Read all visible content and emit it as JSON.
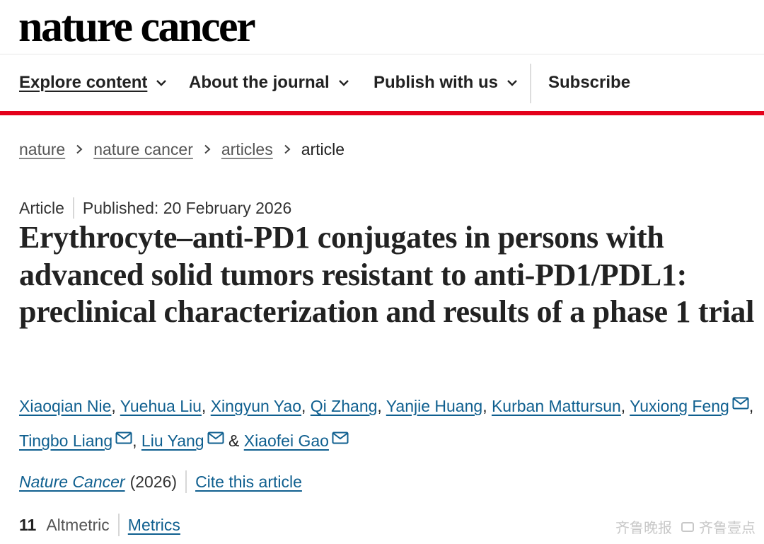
{
  "brand": "nature cancer",
  "colors": {
    "accent_red": "#e4001b",
    "link_blue": "#0f5f8f"
  },
  "nav": {
    "items": [
      {
        "label": "Explore content",
        "icon": "chevron-down-icon",
        "active": true
      },
      {
        "label": "About the journal",
        "icon": "chevron-down-icon"
      },
      {
        "label": "Publish with us",
        "icon": "chevron-down-icon"
      },
      {
        "label": "Subscribe"
      }
    ]
  },
  "breadcrumb": {
    "items": [
      "nature",
      "nature cancer",
      "articles"
    ],
    "current": "article",
    "separator_icon": "chevron-right-icon"
  },
  "article": {
    "type": "Article",
    "published": "Published: 20 February 2026",
    "title": "Erythrocyte–anti-PD1 conjugates in persons with advanced solid tumors resistant to anti-PD1/PDL1: preclinical characterization and results of a phase 1 trial",
    "authors": [
      "Xiaoqian Nie",
      "Yuehua Liu",
      "Xingyun Yao",
      "Qi Zhang",
      "Yanjie Huang",
      "Kurban Mattursun",
      "Yuxiong Feng",
      "Tingbo Liang",
      "Liu Yang",
      "Xiaofei Gao"
    ],
    "author_sep": ",",
    "author_and": "&",
    "corresponding_icon": "mail-icon",
    "journal": "Nature Cancer",
    "year": "(2026)",
    "cite_label": "Cite this article",
    "altmetric_score": "11",
    "altmetric_label": "Altmetric",
    "metrics_label": "Metrics"
  },
  "watermark": {
    "left": "齐鲁晚报",
    "right": "齐鲁壹点"
  }
}
